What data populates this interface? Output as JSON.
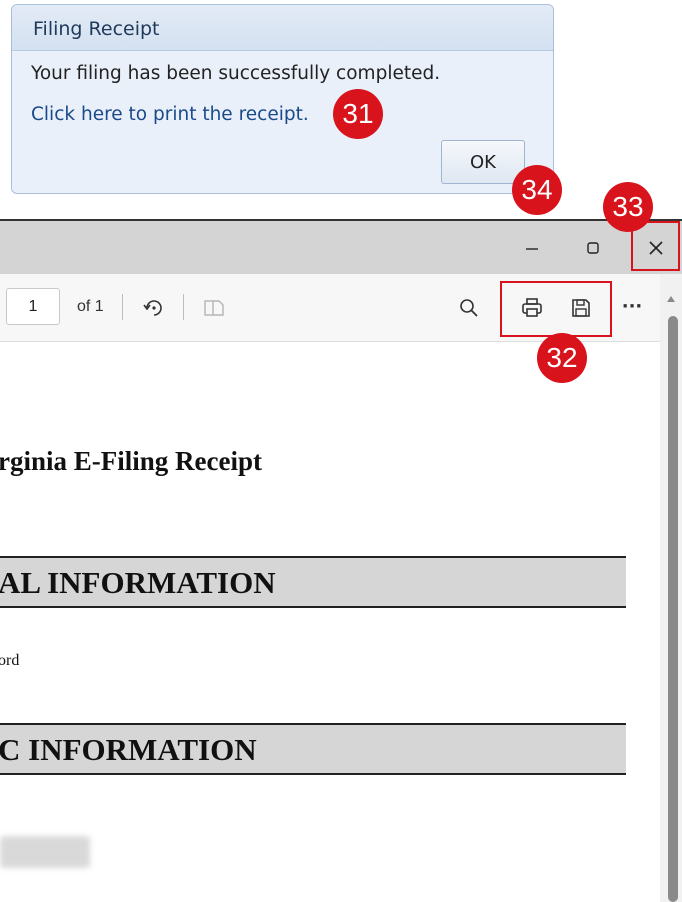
{
  "dialog": {
    "title": "Filing Receipt",
    "message": "Your filing has been successfully completed.",
    "print_link": "Click here to print the receipt.",
    "ok_label": "OK"
  },
  "badges": {
    "print_link": "31",
    "toolbar_actions": "32",
    "close": "33",
    "ok": "34"
  },
  "toolbar": {
    "page_number": "1",
    "page_count_label": "of 1",
    "icons": [
      "rotate-icon",
      "two-page-icon",
      "search-icon",
      "print-icon",
      "save-icon",
      "more-icon"
    ],
    "more_label": "···"
  },
  "window_controls": [
    "minimize",
    "maximize",
    "close"
  ],
  "document": {
    "title": "rginia E-Filing Receipt",
    "section1": "AL INFORMATION",
    "fragment": "ord",
    "section2": "C INFORMATION"
  },
  "colors": {
    "annotation_red": "#d9131b",
    "dialog_bg": "#e9f0fa",
    "titlebar_bg": "#d4d4d4",
    "section_bg": "#d6d6d6"
  }
}
